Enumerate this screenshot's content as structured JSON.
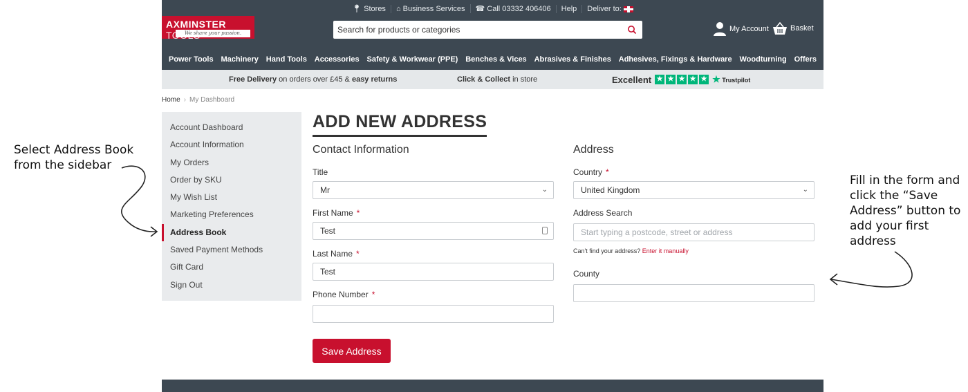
{
  "annotations": {
    "left": "Select Address Book from the sidebar",
    "right": "Fill in the form and click the “Save Address” button to add your first address"
  },
  "header": {
    "utility": {
      "stores": "Stores",
      "business": "Business Services",
      "call": "Call 03332 406406",
      "help": "Help",
      "deliver": "Deliver to:"
    },
    "logo": {
      "brand": "AXMINSTER",
      "brand_light": "TOOLS",
      "tagline": "We share your passion."
    },
    "search_placeholder": "Search for products or categories",
    "account_label": "My Account",
    "basket_label": "Basket",
    "nav": [
      "Power Tools",
      "Machinery",
      "Hand Tools",
      "Accessories",
      "Safety & Workwear (PPE)",
      "Benches & Vices",
      "Abrasives & Finishes",
      "Adhesives, Fixings & Hardware",
      "Woodturning",
      "Offers"
    ]
  },
  "promo": {
    "free_delivery_bold": "Free Delivery",
    "free_delivery_rest": " on orders over £45 & ",
    "easy_returns": "easy returns",
    "click_collect_bold": "Click & Collect",
    "click_collect_rest": " in store",
    "rating_word": "Excellent",
    "trustpilot": "Trustpilot"
  },
  "breadcrumb": {
    "home": "Home",
    "current": "My Dashboard"
  },
  "sidebar": {
    "items": [
      "Account Dashboard",
      "Account Information",
      "My Orders",
      "Order by SKU",
      "My Wish List",
      "Marketing Preferences",
      "Address Book",
      "Saved Payment Methods",
      "Gift Card",
      "Sign Out"
    ],
    "active": "Address Book"
  },
  "form": {
    "title": "ADD NEW ADDRESS",
    "contact_heading": "Contact Information",
    "title_label": "Title",
    "title_value": "Mr",
    "first_name_label": "First Name",
    "first_name_value": "Test",
    "last_name_label": "Last Name",
    "last_name_value": "Test",
    "phone_label": "Phone Number",
    "phone_value": "",
    "address_heading": "Address",
    "country_label": "Country",
    "country_value": "United Kingdom",
    "address_search_label": "Address Search",
    "address_search_placeholder": "Start typing a postcode, street or address",
    "cant_find": "Can't find your address?",
    "enter_manually": "Enter it manually",
    "county_label": "County",
    "county_value": "",
    "required_mark": "*",
    "save_label": "Save Address"
  },
  "colors": {
    "brand_red": "#c8102e",
    "header_bg": "#3d4852",
    "promo_bg": "#e5e8ea",
    "trustpilot_green": "#00b67a"
  }
}
